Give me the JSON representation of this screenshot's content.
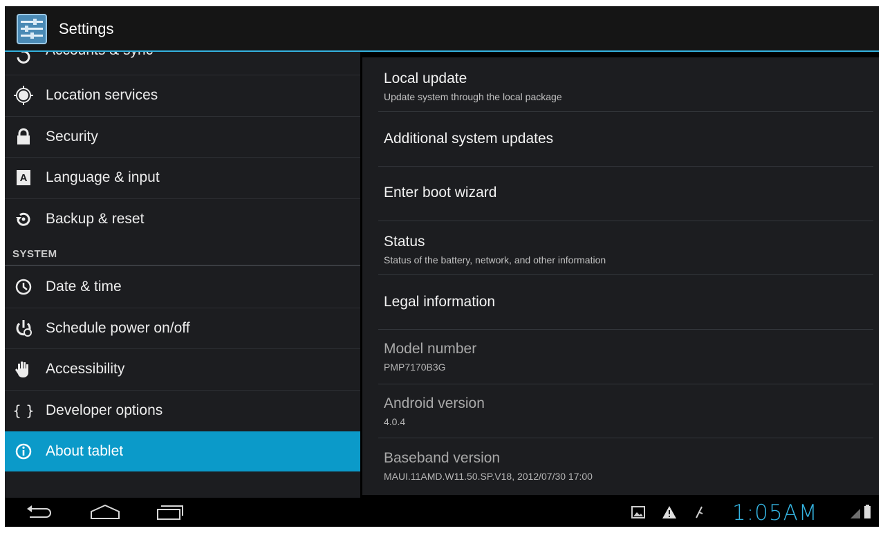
{
  "app": {
    "title": "Settings"
  },
  "sidebar": {
    "partial_item": "Accounts & sync",
    "items": [
      {
        "label": "Location services",
        "icon": "location-icon"
      },
      {
        "label": "Security",
        "icon": "lock-icon"
      },
      {
        "label": "Language & input",
        "icon": "language-icon"
      },
      {
        "label": "Backup & reset",
        "icon": "backup-icon"
      }
    ],
    "section_header": "SYSTEM",
    "system_items": [
      {
        "label": "Date & time",
        "icon": "clock-icon"
      },
      {
        "label": "Schedule power on/off",
        "icon": "power-schedule-icon"
      },
      {
        "label": "Accessibility",
        "icon": "hand-icon"
      },
      {
        "label": "Developer options",
        "icon": "braces-icon"
      },
      {
        "label": "About tablet",
        "icon": "info-icon",
        "selected": true
      }
    ]
  },
  "main": {
    "items": [
      {
        "title": "Local update",
        "summary": "Update system through the local package"
      },
      {
        "title": "Additional system updates"
      },
      {
        "title": "Enter boot wizard"
      },
      {
        "title": "Status",
        "summary": "Status of the battery, network, and other information"
      },
      {
        "title": "Legal information"
      },
      {
        "title": "Model number",
        "summary": "PMP7170B3G"
      },
      {
        "title": "Android version",
        "summary": "4.0.4"
      },
      {
        "title": "Baseband version",
        "summary": "MAUI.11AMD.W11.50.SP.V18, 2012/07/30 17:00"
      }
    ]
  },
  "statusbar": {
    "time": "1:05AM"
  },
  "colors": {
    "accent": "#34b3e0",
    "selected": "#0b9ac9",
    "pane_bg": "#1c1d20"
  }
}
